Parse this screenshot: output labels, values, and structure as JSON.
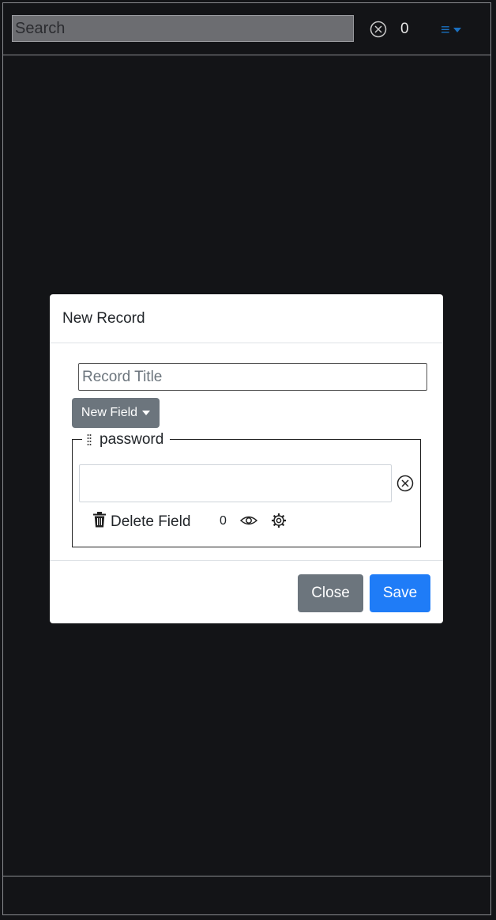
{
  "topbar": {
    "search_placeholder": "Search",
    "count": "0",
    "icons": {
      "clear": "circle-x-icon",
      "menu": "hamburger-menu-icon"
    }
  },
  "modal": {
    "title": "New Record",
    "title_placeholder": "Record Title",
    "new_field_label": "New Field",
    "field": {
      "label": "password",
      "value": "",
      "delete_label": "Delete Field",
      "count": "0",
      "icons": [
        "drag-handle-icon",
        "circle-x-icon",
        "trash-icon",
        "eye-icon",
        "gear-icon"
      ]
    },
    "footer": {
      "close_label": "Close",
      "save_label": "Save"
    }
  },
  "colors": {
    "background": "#131417",
    "primary": "#1f7cf7",
    "secondary": "#6c757d",
    "accent": "#1a6fbf"
  }
}
